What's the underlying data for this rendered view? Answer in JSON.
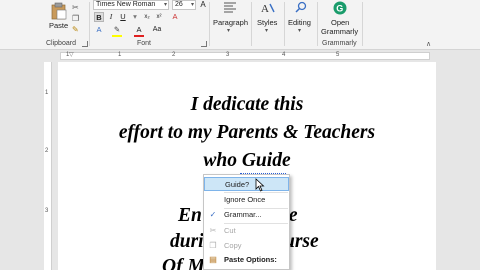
{
  "ribbon": {
    "paste_label": "Paste",
    "clipboard_label": "Clipboard",
    "font_name": "Times New Roman",
    "font_size": "26",
    "font_label": "Font",
    "paragraph_label": "Paragraph",
    "styles_label": "Styles",
    "editing_label": "Editing",
    "open_grammarly_label": "Open Grammarly",
    "open_grammarly_line1": "Open",
    "open_grammarly_line2": "Grammarly",
    "grammarly_group_label": "Grammarly",
    "bold": "B",
    "italic": "I",
    "underline": "U",
    "shrink_font": "A",
    "grow_font": "A",
    "accent": "#1a9c6b"
  },
  "ruler": {
    "h_numbers": [
      "1",
      "1",
      "2",
      "3",
      "4",
      "5"
    ],
    "v_numbers": [
      "1",
      "2",
      "3"
    ]
  },
  "document": {
    "lines": [
      "I dedicate this",
      "effort to my Parents & Teachers",
      "who Guide",
      "En",
      "ne",
      "duri",
      "urse",
      "Of M"
    ]
  },
  "context_menu": {
    "suggestion": "Guide?",
    "ignore_once": "Ignore Once",
    "grammar": "Grammar...",
    "cut": "Cut",
    "copy": "Copy",
    "paste_options": "Paste Options:"
  }
}
